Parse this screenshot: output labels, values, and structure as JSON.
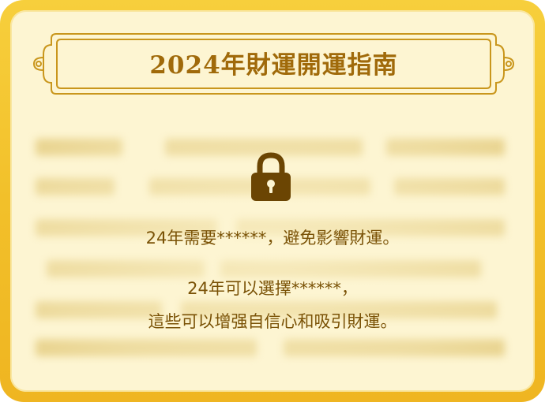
{
  "header": {
    "title": "2024年財運開運指南"
  },
  "lock": {
    "icon": "lock-icon"
  },
  "message": {
    "line1": "24年需要******，避免影響財運。",
    "line2": "24年可以選擇******，",
    "line3": "這些可以增强自信心和吸引財運。"
  },
  "colors": {
    "frame": "#f2c02a",
    "panel": "#fdf5d2",
    "title": "#a06a0a",
    "text": "#7a5206",
    "lock": "#6b4503"
  }
}
